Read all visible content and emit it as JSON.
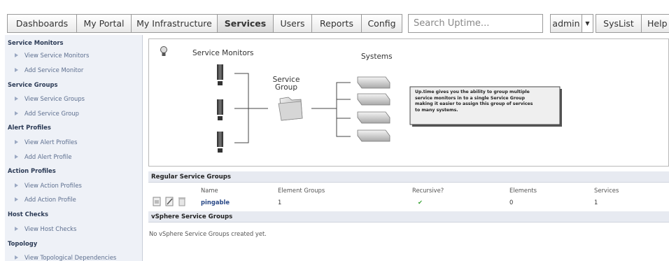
{
  "nav": {
    "tabs": [
      {
        "label": "Dashboards"
      },
      {
        "label": "My Portal"
      },
      {
        "label": "My Infrastructure"
      },
      {
        "label": "Services",
        "active": true
      },
      {
        "label": "Users"
      },
      {
        "label": "Reports"
      },
      {
        "label": "Config"
      }
    ],
    "search_placeholder": "Search Uptime...",
    "user": "admin",
    "syslist": "SysList",
    "help": "Help"
  },
  "sidebar": {
    "sections": [
      {
        "title": "Service Monitors",
        "items": [
          "View Service Monitors",
          "Add Service Monitor"
        ]
      },
      {
        "title": "Service Groups",
        "items": [
          "View Service Groups",
          "Add Service Group"
        ]
      },
      {
        "title": "Alert Profiles",
        "items": [
          "View Alert Profiles",
          "Add Alert Profile"
        ]
      },
      {
        "title": "Action Profiles",
        "items": [
          "View Action Profiles",
          "Add Action Profile"
        ]
      },
      {
        "title": "Host Checks",
        "items": [
          "View Host Checks"
        ]
      },
      {
        "title": "Topology",
        "items": [
          "View Topological Dependencies"
        ]
      }
    ]
  },
  "diagram": {
    "service_monitors_label": "Service Monitors",
    "systems_label": "Systems",
    "service_group_label_1": "Service",
    "service_group_label_2": "Group",
    "callout_lines": [
      "Up.time gives you the ability to group multiple",
      "service monitors in to a single Service Group",
      "making it easier to assign this group of services",
      "to many systems."
    ]
  },
  "regular_groups": {
    "title": "Regular Service Groups",
    "columns": [
      "Name",
      "Element Groups",
      "Recursive?",
      "Elements",
      "Services"
    ],
    "rows": [
      {
        "name": "pingable",
        "element_groups": "1",
        "recursive": "✔",
        "elements": "0",
        "services": "1"
      }
    ]
  },
  "vsphere_groups": {
    "title": "vSphere Service Groups",
    "empty_text": "No vSphere Service Groups created yet."
  },
  "colors": {
    "sidebar_bg": "#eef1f7",
    "section_bar_bg": "#e7eaf1",
    "link": "#2b4a88",
    "check_green": "#3aa335"
  }
}
